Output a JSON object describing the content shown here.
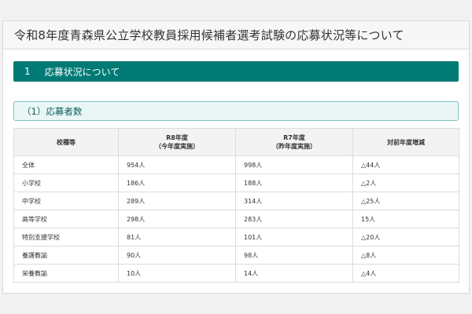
{
  "page_title": "令和8年度青森県公立学校教員採用候補者選考試験の応募状況等について",
  "section": {
    "number": "1",
    "title": "応募状況について"
  },
  "subsection": {
    "title": "（1）応募者数"
  },
  "table": {
    "headers": [
      {
        "line1": "校種等",
        "line2": ""
      },
      {
        "line1": "R8年度",
        "line2": "（今年度実施）"
      },
      {
        "line1": "R7年度",
        "line2": "（昨年度実施）"
      },
      {
        "line1": "対前年度増減",
        "line2": ""
      }
    ],
    "rows": [
      {
        "category": "全体",
        "r8": "954人",
        "r7": "998人",
        "diff": "△44人"
      },
      {
        "category": "小学校",
        "r8": "186人",
        "r7": "188人",
        "diff": "△2人"
      },
      {
        "category": "中学校",
        "r8": "289人",
        "r7": "314人",
        "diff": "△25人"
      },
      {
        "category": "高等学校",
        "r8": "298人",
        "r7": "283人",
        "diff": "15人"
      },
      {
        "category": "特別支援学校",
        "r8": "81人",
        "r7": "101人",
        "diff": "△20人"
      },
      {
        "category": "養護教諭",
        "r8": "90人",
        "r7": "98人",
        "diff": "△8人"
      },
      {
        "category": "栄養教諭",
        "r8": "10人",
        "r7": "14人",
        "diff": "△4人"
      }
    ]
  },
  "colors": {
    "section_bg": "#007a75",
    "subsection_bg": "#eaf6f6",
    "subsection_border": "#7fc3c1"
  }
}
